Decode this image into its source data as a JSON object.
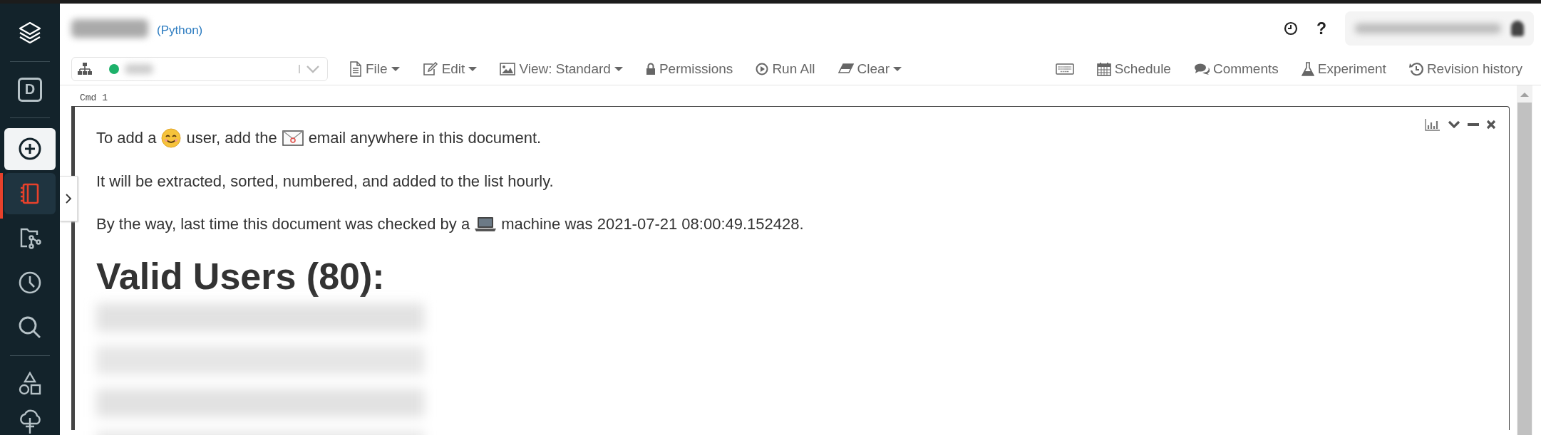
{
  "sidebar": {
    "items": [
      {
        "kind": "logo"
      },
      {
        "kind": "divider"
      },
      {
        "kind": "letter",
        "label": "D",
        "selected": false
      },
      {
        "kind": "divider"
      },
      {
        "kind": "create",
        "selected": false
      },
      {
        "kind": "notebook",
        "selected": true
      },
      {
        "kind": "repos",
        "selected": false
      },
      {
        "kind": "recents",
        "selected": false
      },
      {
        "kind": "search",
        "selected": false
      },
      {
        "kind": "divider"
      },
      {
        "kind": "shapes",
        "selected": false
      },
      {
        "kind": "cloud",
        "selected": false
      }
    ]
  },
  "header": {
    "language": "(Python)",
    "help": "?"
  },
  "toolbar": {
    "cluster": {
      "running": true
    },
    "items": [
      {
        "kind": "file",
        "label": "File",
        "dropdown": true
      },
      {
        "kind": "edit",
        "label": "Edit",
        "dropdown": true
      },
      {
        "kind": "view",
        "label": "View: Standard",
        "dropdown": true
      },
      {
        "kind": "permissions",
        "label": "Permissions",
        "dropdown": false
      },
      {
        "kind": "run",
        "label": "Run All",
        "dropdown": false
      },
      {
        "kind": "clear",
        "label": "Clear",
        "dropdown": true
      }
    ],
    "right_items": [
      {
        "kind": "keyboard",
        "dropdown": false
      },
      {
        "kind": "schedule",
        "label": "Schedule",
        "dropdown": false
      },
      {
        "kind": "comments",
        "label": "Comments",
        "dropdown": false
      },
      {
        "kind": "experiment",
        "label": "Experiment",
        "dropdown": false
      },
      {
        "kind": "revisions",
        "label": "Revision history",
        "dropdown": false
      }
    ]
  },
  "cell": {
    "label": "Cmd 1",
    "paragraphs": [
      [
        {
          "kind": "text",
          "text": "To add a"
        },
        {
          "kind": "smiley"
        },
        {
          "kind": "text",
          "text": "user, add the"
        },
        {
          "kind": "envelope"
        },
        {
          "kind": "text",
          "text": "email anywhere in this document."
        }
      ],
      [
        {
          "kind": "text",
          "text": "It will be extracted, sorted, numbered, and added to the list hourly."
        }
      ],
      [
        {
          "kind": "text",
          "text": "By the way, last time this document was checked by a"
        },
        {
          "kind": "laptop"
        },
        {
          "kind": "text",
          "text": "machine was 2021-07-21 08:00:49.152428."
        }
      ]
    ],
    "heading": "Valid Users (80):"
  }
}
